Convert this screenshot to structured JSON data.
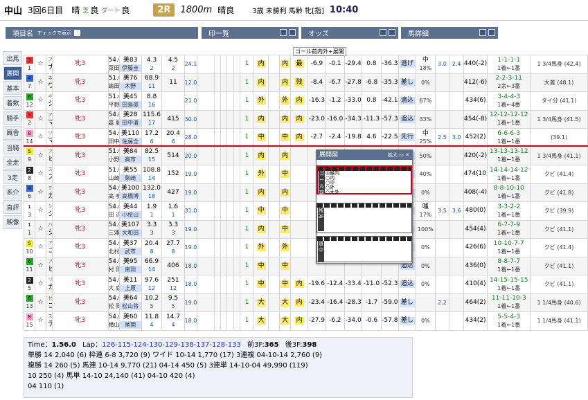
{
  "header": {
    "venue": "中山",
    "meeting": "3回6日目",
    "weather": "晴",
    "going_turf": "芝",
    "going_turf_cond": "良",
    "dirt_label": "ダート",
    "going_dirt": "良",
    "race_no": "2R",
    "distance": "1800m",
    "race_weather": "晴良",
    "class": "3歳 未勝利 馬齢 牝[指]",
    "post_time": "10:40"
  },
  "column_headers": {
    "item": "項目名",
    "show_check": "チェックで表示",
    "marks": "印一覧",
    "odds": "オッズ",
    "details": "馬詳細"
  },
  "sidebar": [
    "出馬",
    "展開",
    "基本",
    "着数",
    "騎手",
    "厩舎",
    "当騎",
    "全走",
    "3走",
    "系介",
    "直評",
    "映像"
  ],
  "goal_note": "ゴール前内外+展開",
  "horses": [
    {
      "gate": "3",
      "num": "1",
      "sire": "アグネスタキオン",
      "name": "ナンヨールージュ",
      "age": "牝3",
      "wt": "54.0",
      "jockey": "菜田豊",
      "trainer": "美83",
      "stable": "伊藤圭",
      "o1": "4.3",
      "o2": "4.5",
      "pop1": "2",
      "pop2": "2",
      "p": "24.1",
      "r1": "内",
      "r2": "内",
      "pos": "最",
      "m1": "-6.9",
      "m2": "-0.1",
      "m3": "-29.4",
      "m4": "0.8",
      "m5": "-36.3",
      "style": "逃げ",
      "r": "中",
      "pct": "18%",
      "g": "3.0",
      "h": "2.4",
      "wt2": "440(-2)",
      "rec": "1-1-1-1",
      "rr": "1着←1番",
      "rank": "1 3/4馬身 (42.4)",
      "c1": "1"
    },
    {
      "gate": "4",
      "num": "7",
      "sire": "ネオユニヴァース",
      "name": "ワンステップ",
      "age": "牝3",
      "wt": "51.0▲",
      "jockey": "嶋田純",
      "trainer": "美76",
      "stable": "木野",
      "o1": "68.9",
      "o2": "11",
      "pop1": "11",
      "pop2": "",
      "p": "12.0",
      "r1": "内",
      "r2": "内",
      "pos": "残",
      "m1": "-8.4",
      "m2": "-6.7",
      "m3": "-27.8",
      "m4": "-6.8",
      "m5": "-35.3",
      "style": "差し",
      "r": "",
      "pct": "0%",
      "g": "",
      "h": "",
      "wt2": "412(-6)",
      "rec": "2-2-3-11",
      "rr": "2余←3番",
      "rank": "大差 (48.1)",
      "c1": "1"
    },
    {
      "gate": "6",
      "num": "12",
      "sire": "キングカメハメハ",
      "name": "ショウナンラランパス",
      "age": "牝3",
      "wt": "51.0▲",
      "jockey": "平野優",
      "trainer": "美45",
      "stable": "田島俊",
      "o1": "8.8",
      "o2": "",
      "pop1": "16",
      "pop2": "",
      "p": "21.0",
      "r1": "外",
      "r2": "外",
      "pos": "内",
      "m1": "-16.3",
      "m2": "-1.2",
      "m3": "-33.0",
      "m4": "0.8",
      "m5": "-42.1",
      "style": "追込",
      "r": "",
      "pct": "67%",
      "g": "",
      "h": "",
      "wt2": "434(6)",
      "rec": "3-4-4-3",
      "rr": "1着←4番",
      "rank": "タイ分 (41.1)",
      "c1": "1"
    },
    {
      "gate": "3",
      "num": "2",
      "sire": "アグネスフライト",
      "name": "マツコリ",
      "age": "牝3",
      "wt": "54.0",
      "jockey": "嘉 藤",
      "trainer": "美28",
      "stable": "田中清",
      "o1": "115.6",
      "o2": "415",
      "pop1": "17",
      "pop2": "",
      "p": "30.0",
      "r1": "内",
      "r2": "内",
      "pos": "内",
      "m1": "-23.0",
      "m2": "-16.0",
      "m3": "-34.3",
      "m4": "-11.3",
      "m5": "-57.3",
      "style": "追込",
      "r": "",
      "pct": "33%",
      "g": "",
      "h": "",
      "wt2": "454(-8)",
      "rec": "12-12-12-12",
      "rr": "1着←1番",
      "rank": "1 3/4馬身 (41.5)",
      "c1": "1"
    },
    {
      "gate": "8",
      "num": "14",
      "sire": "リンカーン",
      "name": "マンマルコ",
      "age": "牝3",
      "wt": "54.0",
      "jockey": "田中勝",
      "trainer": "美110",
      "stable": "佐藤全",
      "o1": "17.2",
      "o2": "20.4",
      "pop1": "6",
      "pop2": "6",
      "p": "28.0",
      "r1": "中",
      "r2": "中",
      "pos": "内",
      "m1": "-2.7",
      "m2": "-2.4",
      "m3": "-19.8",
      "m4": "4.6",
      "m5": "-22.5",
      "style": "先行",
      "r": "中",
      "pct": "25%",
      "g": "2.5",
      "h": "3.0",
      "wt2": "452(2)",
      "rec": "6-6-6-3",
      "rr": "1着←1番",
      "rank": "(39.1)",
      "c1": "1"
    },
    {
      "gate": "5",
      "num": "9",
      "sire": "アメリカンボス",
      "name": "ヒダノエリー",
      "age": "牝3",
      "wt": "51.0▲",
      "jockey": "小野寺",
      "trainer": "美84",
      "stable": "高市",
      "o1": "82.5",
      "o2": "514",
      "pop1": "15",
      "pop2": "",
      "p": "20.0",
      "r1": "内",
      "r2": "内",
      "pos": "",
      "m1": "",
      "m2": "",
      "m3": "",
      "m4": "",
      "m5": "-32.6",
      "style": "追込",
      "r": "",
      "pct": "50%",
      "g": "",
      "h": "",
      "wt2": "420(-2)",
      "rec": "13-13-13-12",
      "rr": "1着←1番",
      "rank": "1 3/4馬身 (41.1)",
      "c1": "1"
    },
    {
      "gate": "2",
      "num": "8",
      "sire": "スターリングローズ",
      "name": "スターブルーウッド",
      "age": "牝3",
      "wt": "51.0▲",
      "jockey": "山崎誠",
      "trainer": "美55",
      "stable": "柴崎",
      "o1": "108.8",
      "o2": "152",
      "pop1": "14",
      "pop2": "",
      "p": "19.0",
      "r1": "外",
      "r2": "中",
      "pos": "",
      "m1": "",
      "m2": "",
      "m3": "",
      "m4": "",
      "m5": "",
      "style": "差し",
      "r": "",
      "pct": "40%",
      "g": "",
      "h": "",
      "wt2": "474(10)",
      "rec": "14-14-14-12",
      "rr": "1着←1番",
      "rank": "クビ (41.4)",
      "c1": "1"
    },
    {
      "gate": "4",
      "num": "6",
      "sire": "ディンバーカントリー",
      "name": "ガンバルンバ",
      "age": "牝3",
      "wt": "54.0",
      "jockey": "高 鳴",
      "trainer": "美100",
      "stable": "高橋博",
      "o1": "132.0",
      "o2": "427",
      "pop1": "18",
      "pop2": "",
      "p": "19.0",
      "r1": "内",
      "r2": "内",
      "pos": "",
      "m1": "",
      "m2": "",
      "m3": "",
      "m4": "",
      "m5": "",
      "style": "追込",
      "r": "",
      "pct": "0%",
      "g": "",
      "h": "",
      "wt2": "408(-4)",
      "rec": "8-8-10-10",
      "rr": "1着←1番",
      "rank": "クビ (41.8)",
      "c1": "1"
    },
    {
      "gate": "1",
      "num": "3",
      "sire": "シンボリクリスエス",
      "name": "ジャマイカラー",
      "age": "牝3",
      "wt": "54.0",
      "jockey": "田 辺",
      "trainer": "美44",
      "stable": "小桧山",
      "o1": "1.9",
      "o2": "1.6",
      "pop1": "1",
      "pop2": "1",
      "p": "31.0",
      "r1": "中",
      "r2": "中",
      "pos": "",
      "m1": "",
      "m2": "",
      "m3": "",
      "m4": "",
      "m5": "",
      "style": "好差",
      "r": "嗤",
      "pct": "17%",
      "g": "3.5",
      "h": "3.6",
      "wt2": "480(0)",
      "rec": "3-3-2-2",
      "rr": "1着←1番",
      "rank": "クビ (39.9)",
      "c1": "1"
    },
    {
      "gate": "1",
      "num": "1",
      "sire": "ハーツクライ",
      "name": "シースブレイ",
      "age": "牝3",
      "wt": "54.0",
      "jockey": "三浦皇",
      "trainer": "美107",
      "stable": "大和田",
      "o1": "3.3",
      "o2": "3.3",
      "pop1": "3",
      "pop2": "3",
      "p": "19.0",
      "r1": "内",
      "r2": "中",
      "pos": "",
      "m1": "",
      "m2": "",
      "m3": "",
      "m4": "",
      "m5": "",
      "style": "追込",
      "r": "",
      "pct": "100%",
      "g": "",
      "h": "",
      "wt2": "454(4)",
      "rec": "6-7-7-9",
      "rr": "1着←1番",
      "rank": "クビ (41.1)",
      "c1": "1"
    },
    {
      "gate": "5",
      "num": "10",
      "sire": "アドマイヤジャパン",
      "name": "ココアンジュ",
      "age": "牝3",
      "wt": "54.0",
      "jockey": "北村宏",
      "trainer": "美37",
      "stable": "武市",
      "o1": "20.4",
      "o2": "27.7",
      "pop1": "8",
      "pop2": "8",
      "p": "19.0",
      "r1": "外",
      "r2": "外",
      "pos": "",
      "m1": "",
      "m2": "",
      "m3": "",
      "m4": "",
      "m5": "",
      "style": "差し",
      "r": "",
      "pct": "0%",
      "g": "",
      "h": "",
      "wt2": "426(6)",
      "rec": "10-10-7-7",
      "rr": "1着←1番",
      "rank": "クビ (41.4)",
      "c1": "1"
    },
    {
      "gate": "6",
      "num": "11",
      "sire": "アフリート",
      "name": "ヒカリエンジェル",
      "age": "牝3",
      "wt": "54.0",
      "jockey": "村 田",
      "trainer": "美95",
      "stable": "南田",
      "o1": "66.9",
      "o2": "406",
      "pop1": "14",
      "pop2": "",
      "p": "18.0",
      "r1": "中",
      "r2": "中",
      "pos": "",
      "m1": "",
      "m2": "",
      "m3": "",
      "m4": "",
      "m5": "",
      "style": "追込",
      "r": "",
      "pct": "0%",
      "g": "",
      "h": "",
      "wt2": "436(0)",
      "rec": "8-8-7-7",
      "rr": "1着←1番",
      "rank": "クビ (41.1)",
      "c1": "1"
    },
    {
      "gate": "2",
      "num": "5",
      "sire": "リンカーン",
      "name": "カトレアシチー",
      "age": "牝3",
      "wt": "54.0",
      "jockey": "大 庭",
      "trainer": "美11",
      "stable": "上原",
      "o1": "97.6",
      "o2": "251",
      "pop1": "12",
      "pop2": "12",
      "p": "18.0",
      "r1": "中",
      "r2": "中",
      "pos": "内",
      "m1": "-19.6",
      "m2": "-12.4",
      "m3": "-33.4",
      "m4": "-11.0",
      "m5": "-52.3",
      "style": "追込",
      "r": "",
      "pct": "0%",
      "g": "",
      "h": "",
      "wt2": "410(4)",
      "rec": "14-15-15-15",
      "rr": "1着←1番",
      "rank": "クビ (41.1)",
      "c1": "1"
    },
    {
      "gate": "6",
      "num": "13",
      "sire": "ゼンノロブロイ",
      "name": "コスモシャオロン",
      "age": "牝3",
      "wt": "54.0",
      "jockey": "松 岡",
      "trainer": "美64",
      "stable": "松山将",
      "o1": "10.2",
      "o2": "9.5",
      "pop1": "5",
      "pop2": "5",
      "p": "19.0",
      "r1": "大",
      "r2": "大",
      "pos": "内",
      "m1": "-23.4",
      "m2": "-16.4",
      "m3": "-28.3",
      "m4": "-1.7",
      "m5": "-59.0",
      "style": "差し",
      "r": "",
      "pct": "",
      "g": "2.2",
      "h": "",
      "wt2": "464(2)",
      "rec": "11-11-10-3",
      "rr": "1着←1番",
      "rank": "1 1/4馬身 (40.6)",
      "c1": "1"
    },
    {
      "gate": "8",
      "num": "15",
      "sire": "スリリングサンデー",
      "name": "デルマアブサラス",
      "age": "牝3",
      "wt": "54.0",
      "jockey": "横山典",
      "trainer": "美60",
      "stable": "尾関",
      "o1": "11.8",
      "o2": "14.7",
      "pop1": "4",
      "pop2": "4",
      "p": "18.0",
      "r1": "大",
      "r2": "大",
      "pos": "内",
      "m1": "-27.9",
      "m2": "-6.2",
      "m3": "-34.0",
      "m4": "-0.6",
      "m5": "-57.8",
      "style": "差し",
      "r": "",
      "pct": "0%",
      "g": "",
      "h": "",
      "wt2": "434(2)",
      "rec": "5-5-4-3",
      "rr": "1着←1番",
      "rank": "1 1/4馬身 (41.1)",
      "c1": "1"
    }
  ],
  "popup": {
    "title": "展開図",
    "ctrl": "拡大",
    "rows": [
      "ゴール前",
      "残3F",
      "道中"
    ],
    "marks_a": [
      "最内",
      "内",
      "中",
      "外",
      "大外"
    ]
  },
  "footer": {
    "time_label": "Time：",
    "time": "1.56.0",
    "lap_label": "Lap：",
    "lap": "126-115-124-130-129-138-137-128-133",
    "front3f_label": "前3F:",
    "front3f": "365",
    "back3f_label": "後3F:",
    "back3f": "398",
    "l1": "単勝 14 2,040 (6)   枠連  6-8   3,720  (9)  ワイド 10-14 1,770 (17)  3連複 04-10-14  2,760  (9)",
    "l2": "複勝 14  260  (5)  馬連 10-14  9,770 (21)       04-14   450  (5)  3連単 14-10-04 49,990 (119)",
    "l3": "     10  250  (4)  馬単 14-10 24,140 (41)       04-10   420  (4)",
    "l4": "     04  110  (1)"
  }
}
